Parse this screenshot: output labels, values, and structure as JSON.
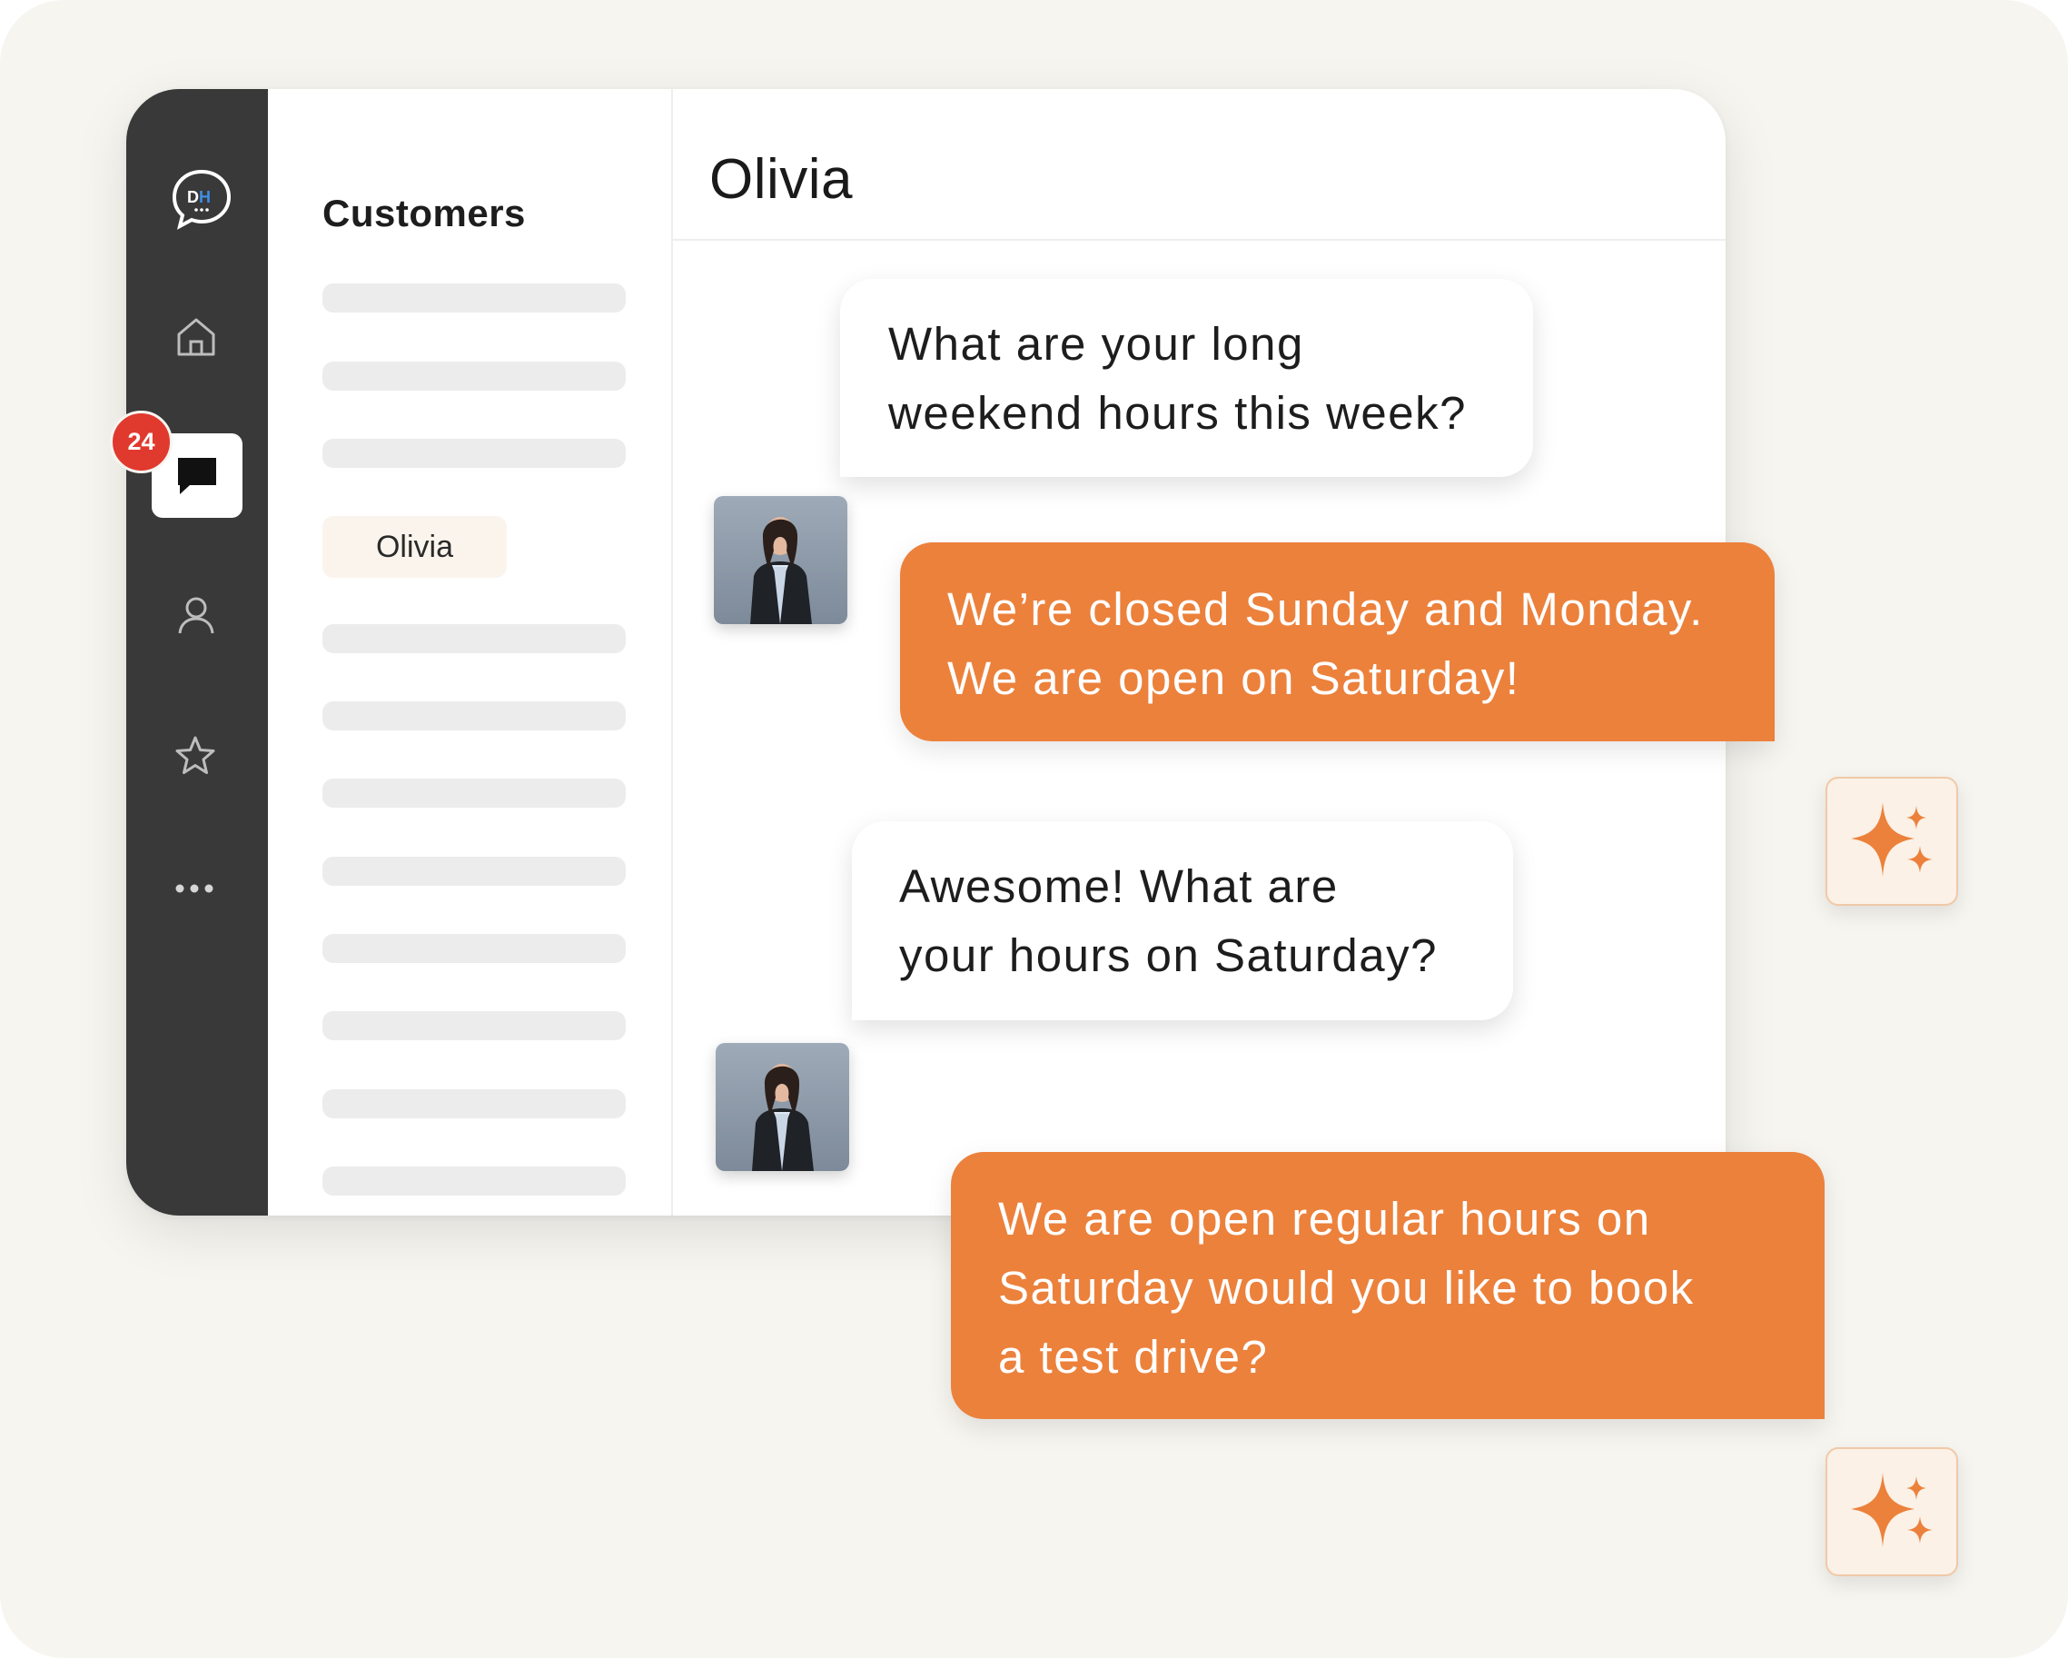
{
  "app": {
    "logo_icon": "dh-chat-logo-icon",
    "unread_badge": "24",
    "nav_icons": [
      "home-icon",
      "chat-icon",
      "user-icon",
      "star-icon",
      "more-icon"
    ]
  },
  "customers": {
    "title": "Customers",
    "selected": "Olivia"
  },
  "conversation": {
    "title": "Olivia",
    "messages": [
      {
        "from": "customer",
        "text": "What are your long\nweekend hours this week?"
      },
      {
        "from": "agent",
        "text": "We’re closed Sunday and Monday.\nWe are open on Saturday!"
      },
      {
        "from": "customer",
        "text": "Awesome! What are\nyour hours on Saturday?"
      },
      {
        "from": "agent",
        "text": "We are open regular hours on\nSaturday would you like to book\na test drive?"
      }
    ]
  },
  "colors": {
    "rail": "#393939",
    "accent": "#ec813c",
    "badge": "#e03a2e",
    "background": "#f6f5f0",
    "sparkle": "#ec813c"
  },
  "icons": {
    "ai_reply": "sparkle-icon"
  }
}
